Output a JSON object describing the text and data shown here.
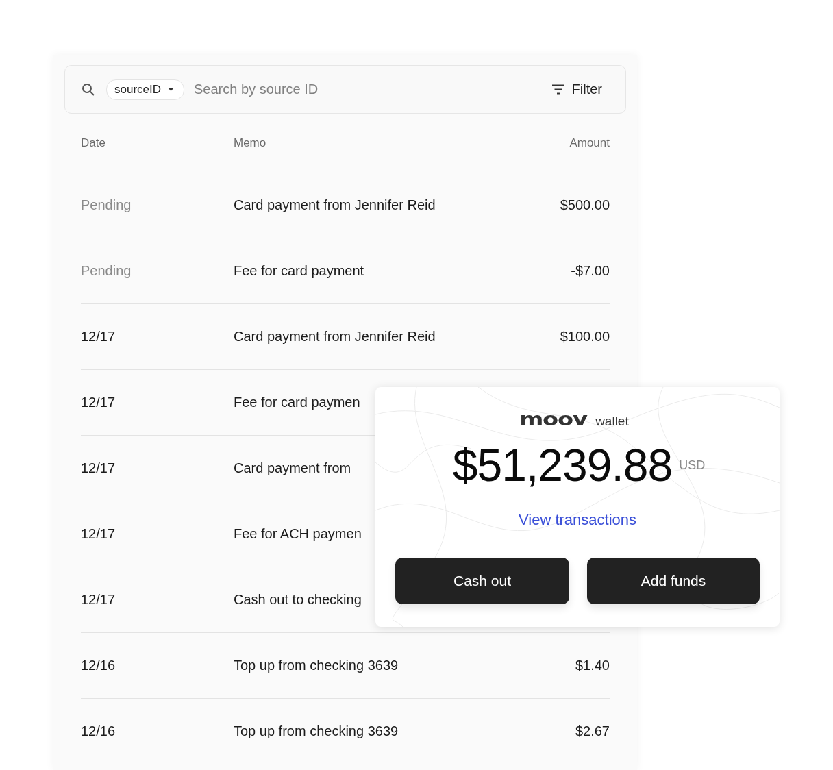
{
  "search": {
    "field_chip": "sourceID",
    "placeholder": "Search by source ID",
    "filter_label": "Filter"
  },
  "table": {
    "columns": [
      "Date",
      "Memo",
      "Amount"
    ],
    "rows": [
      {
        "date": "Pending",
        "pending": true,
        "memo": "Card payment from Jennifer Reid",
        "amount": "$500.00"
      },
      {
        "date": "Pending",
        "pending": true,
        "memo": "Fee for card payment",
        "amount": "-$7.00"
      },
      {
        "date": "12/17",
        "pending": false,
        "memo": "Card payment from Jennifer Reid",
        "amount": "$100.00"
      },
      {
        "date": "12/17",
        "pending": false,
        "memo": "Fee for card paymen"
      },
      {
        "date": "12/17",
        "pending": false,
        "memo": "Card payment from"
      },
      {
        "date": "12/17",
        "pending": false,
        "memo": "Fee for ACH paymen"
      },
      {
        "date": "12/17",
        "pending": false,
        "memo": "Cash out to checking"
      },
      {
        "date": "12/16",
        "pending": false,
        "memo": "Top up from checking 3639",
        "amount": "$1.40"
      },
      {
        "date": "12/16",
        "pending": false,
        "memo": "Top up from checking 3639",
        "amount": "$2.67"
      }
    ]
  },
  "wallet": {
    "logo": "moov",
    "label": "wallet",
    "balance": "$51,239.88",
    "currency": "USD",
    "link": "View transactions",
    "buttons": [
      "Cash out",
      "Add funds"
    ]
  }
}
